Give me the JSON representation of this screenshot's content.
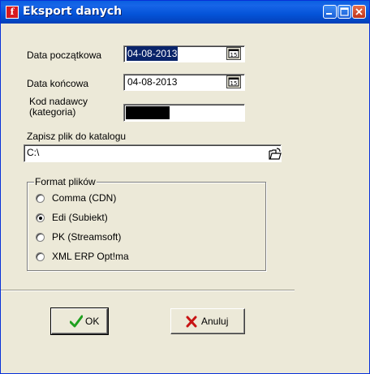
{
  "window": {
    "title": "Eksport danych",
    "app_icon_glyph": "f"
  },
  "form": {
    "date_start_label": "Data początkowa",
    "date_start_value": "04-08-2013",
    "date_end_label": "Data końcowa",
    "date_end_value": "04-08-2013",
    "calendar_glyph": "15",
    "sender_code_label_line1": "Kod nadawcy",
    "sender_code_label_line2": "(kategoria)",
    "save_dir_label": "Zapisz plik do katalogu",
    "save_dir_value": "C:\\"
  },
  "format_group": {
    "legend": "Format plików",
    "options": [
      {
        "label": "Comma (CDN)",
        "selected": false
      },
      {
        "label": "Edi (Subiekt)",
        "selected": true
      },
      {
        "label": "PK (Streamsoft)",
        "selected": false
      },
      {
        "label": "XML ERP Opt!ma",
        "selected": false
      }
    ]
  },
  "buttons": {
    "ok_label": "OK",
    "cancel_label": "Anuluj"
  },
  "colors": {
    "titlebar": "#0453d8",
    "selection": "#0a246a",
    "ok_check": "#1ea01e",
    "cancel_x": "#c81414"
  }
}
